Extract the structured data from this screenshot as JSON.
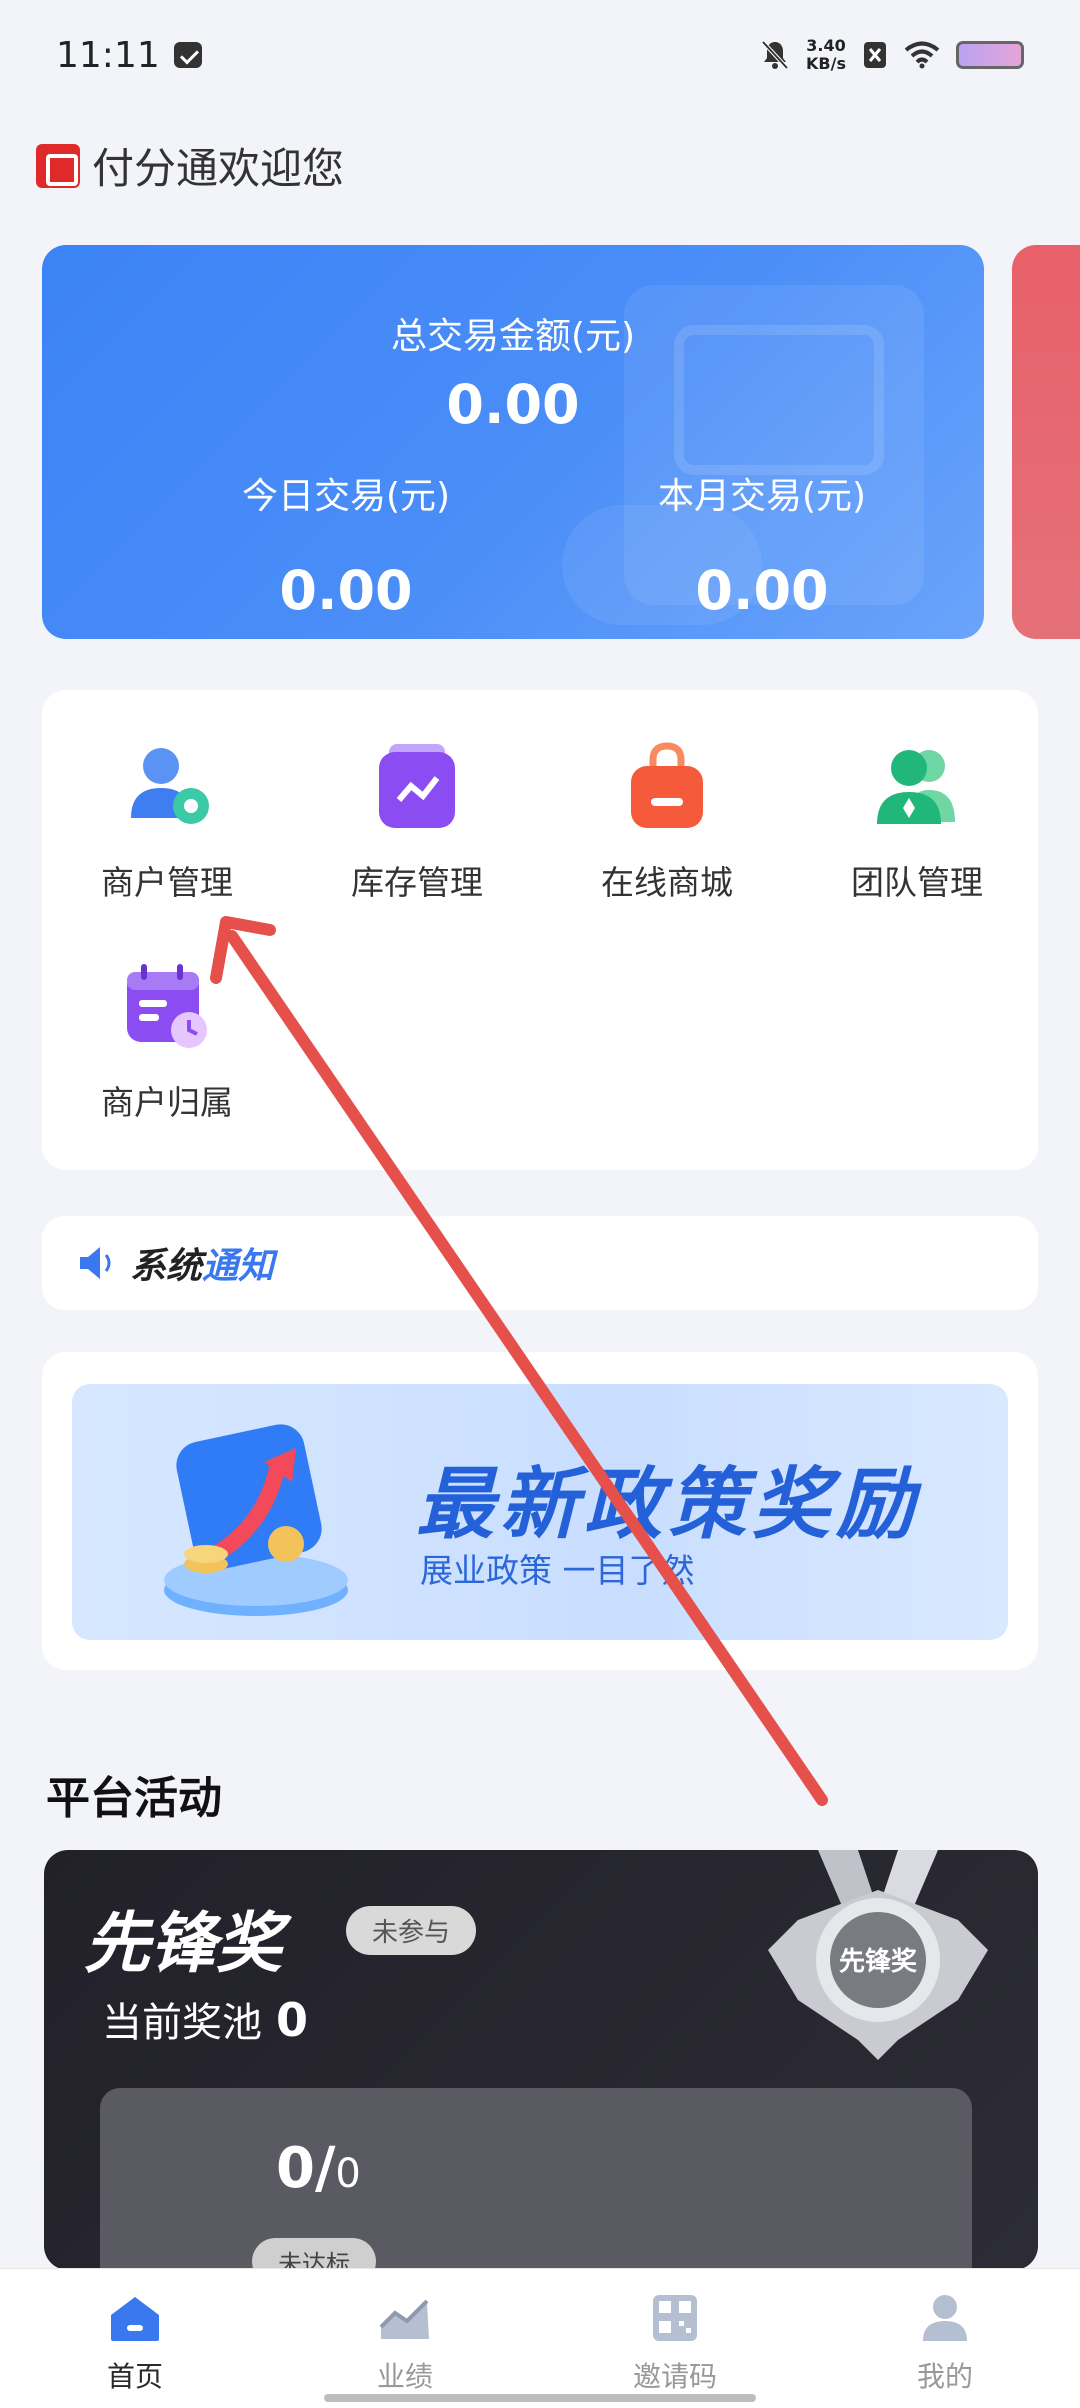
{
  "status_bar": {
    "time": "11:11",
    "speed_value": "3.40",
    "speed_unit": "KB/s"
  },
  "header": {
    "welcome": "付分通欢迎您"
  },
  "stats": {
    "total_label": "总交易金额(元)",
    "total_value": "0.00",
    "today_label": "今日交易(元)",
    "today_value": "0.00",
    "month_label": "本月交易(元)",
    "month_value": "0.00"
  },
  "menu": {
    "items": [
      {
        "label": "商户管理",
        "icon": "merchant-user-icon"
      },
      {
        "label": "库存管理",
        "icon": "inventory-chart-icon"
      },
      {
        "label": "在线商城",
        "icon": "shopping-bag-icon"
      },
      {
        "label": "团队管理",
        "icon": "team-icon"
      },
      {
        "label": "商户归属",
        "icon": "calendar-clock-icon"
      }
    ]
  },
  "notice": {
    "title_part1": "系统",
    "title_part2": "通知"
  },
  "banner": {
    "title": "最新政策奖励",
    "subtitle": "展业政策 一目了然"
  },
  "activity": {
    "section_title": "平台活动",
    "name": "先锋奖",
    "badge": "未参与",
    "pool_label": "当前奖池",
    "pool_value": "0",
    "medal_text": "先锋奖",
    "progress_done": "0/",
    "progress_total": "0",
    "progress_status": "未达标"
  },
  "tabbar": {
    "tabs": [
      {
        "label": "首页",
        "icon": "home-icon",
        "active": true
      },
      {
        "label": "业绩",
        "icon": "performance-chart-icon",
        "active": false
      },
      {
        "label": "邀请码",
        "icon": "qr-code-icon",
        "active": false
      },
      {
        "label": "我的",
        "icon": "profile-icon",
        "active": false
      }
    ]
  },
  "colors": {
    "accent_blue": "#3c83f6",
    "annotation_arrow": "#e5504a",
    "activity_card_bg": "#22212a"
  }
}
